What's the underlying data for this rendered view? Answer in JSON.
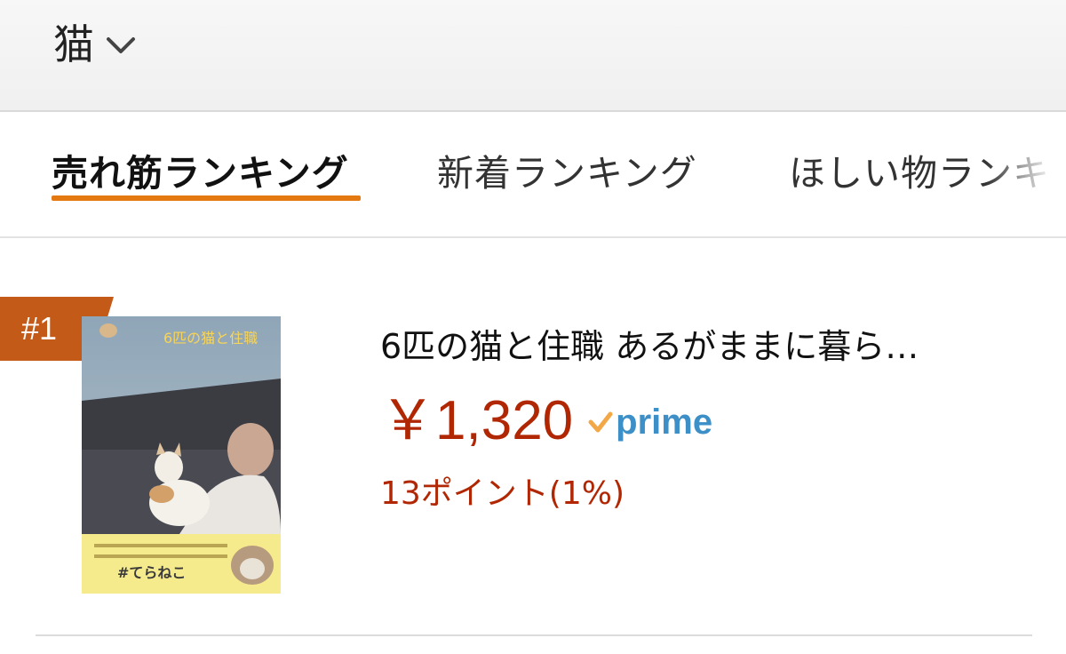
{
  "header": {
    "category_label": "猫",
    "icons": {
      "dropdown": "chevron-down-icon"
    }
  },
  "tabs": [
    {
      "label": "売れ筋ランキング",
      "active": true
    },
    {
      "label": "新着ランキング",
      "active": false
    },
    {
      "label": "ほしい物ランキング",
      "active": false
    }
  ],
  "product": {
    "rank": "#1",
    "title": "6匹の猫と住職 あるがままに暮ら…",
    "price": "￥1,320",
    "prime_label": "prime",
    "points": "13ポイント(1%)",
    "cover_title": "6匹の猫と住職",
    "cover_tagline": "#てらねこ"
  },
  "colors": {
    "accent": "#e47911",
    "price": "#b12704",
    "rank_badge": "#c45a18",
    "prime": "#3c8fc7",
    "prime_check": "#f3a847"
  }
}
